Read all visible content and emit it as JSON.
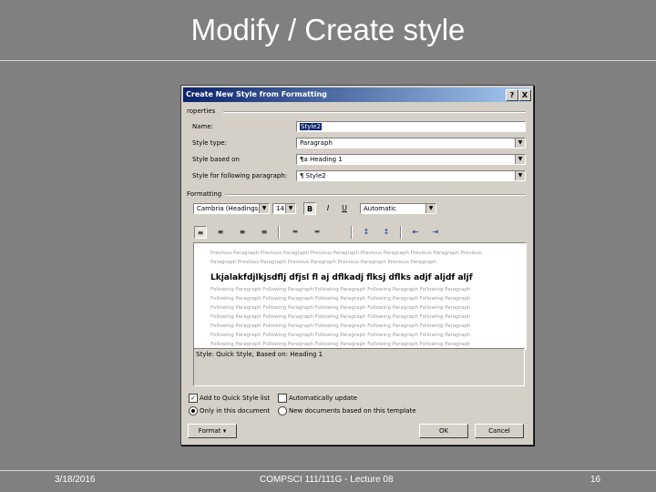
{
  "slide": {
    "title": "Modify / Create style",
    "footer_date": "3/18/2016",
    "footer_course": "COMPSCI 111/111G - Lecture 08",
    "footer_page": "16"
  },
  "dialog": {
    "title": "Create New Style from Formatting",
    "help_btn": "?",
    "close_btn": "X",
    "properties_label": "roperties",
    "name_label": "Name:",
    "name_value": "Style2",
    "style_type_label": "Style type:",
    "style_type_value": "Paragraph",
    "based_on_label": "Style based on",
    "based_on_value": "¶a Heading 1",
    "following_label": "Style for following paragraph:",
    "following_value": "¶ Style2",
    "formatting_label": "Formatting",
    "font_value": "Cambria (Headings)",
    "size_value": "14",
    "bold_btn": "B",
    "italic_btn": "I",
    "underline_btn": "U",
    "color_value": "Automatic",
    "preview_before": [
      "Previous Paragraph Previous Paragraph Previous Paragraph Previous Paragraph Previous Paragraph Previous",
      "Paragraph Previous Paragraph Previous Paragraph Previous Paragraph Previous Paragraph"
    ],
    "preview_sample": "Lkjalakfdjlkjsdflj dfjsl fl aj dflkadj flksj dflks adjf aljdf aljf",
    "preview_after": [
      "Following Paragraph Following Paragraph Following Paragraph Following Paragraph Following Paragraph",
      "Following Paragraph Following Paragraph Following Paragraph Following Paragraph Following Paragraph",
      "Following Paragraph Following Paragraph Following Paragraph Following Paragraph Following Paragraph",
      "Following Paragraph Following Paragraph Following Paragraph Following Paragraph Following Paragraph",
      "Following Paragraph Following Paragraph Following Paragraph Following Paragraph Following Paragraph",
      "Following Paragraph Following Paragraph Following Paragraph Following Paragraph Following Paragraph",
      "Following Paragraph Following Paragraph Following Paragraph Following Paragraph Following Paragraph"
    ],
    "description": "Style: Quick Style, Based on: Heading 1",
    "add_quick_style_label": "Add to Quick Style list",
    "auto_update_label": "Automatically update",
    "only_this_doc_label": "Only in this document",
    "new_docs_label": "New documents based on this template",
    "format_btn": "Format ▾",
    "ok_btn": "OK",
    "cancel_btn": "Cancel"
  }
}
